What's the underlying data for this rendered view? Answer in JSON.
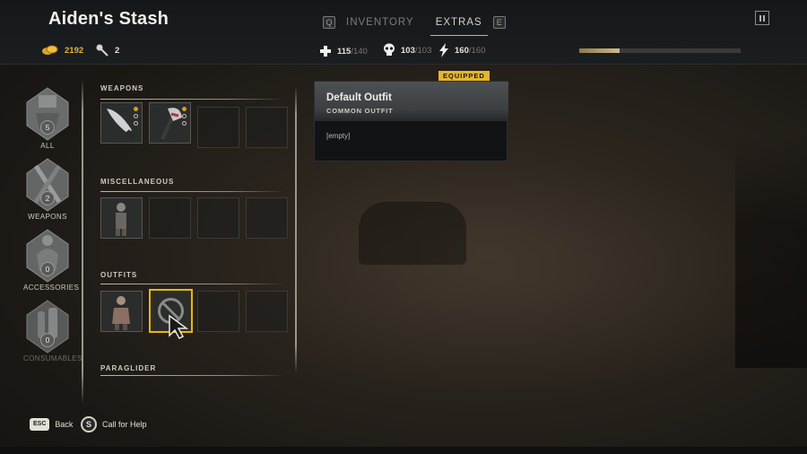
{
  "header": {
    "title": "Aiden's Stash",
    "tabs": [
      {
        "key": "Q",
        "label": ""
      },
      {
        "label": "INVENTORY",
        "active": false
      },
      {
        "label": "EXTRAS",
        "active": true
      },
      {
        "key": "E",
        "label": ""
      }
    ],
    "tab_prev_key": "Q",
    "tab_inventory": "INVENTORY",
    "tab_extras": "EXTRAS",
    "tab_next_key": "E",
    "pause_icon": "pause-icon"
  },
  "stats": {
    "gold_value": "2192",
    "lockpick_value": "2",
    "health_value": "115",
    "health_max": "/140",
    "immunity_value": "103",
    "immunity_max": "/103",
    "stamina_value": "160",
    "stamina_max": "/160",
    "xp_fill_fraction": 0.25
  },
  "categories": [
    {
      "name": "ALL",
      "count": "5",
      "dim": false
    },
    {
      "name": "WEAPONS",
      "count": "2",
      "dim": false
    },
    {
      "name": "ACCESSORIES",
      "count": "0",
      "dim": false
    },
    {
      "name": "CONSUMABLES",
      "count": "0",
      "dim": true
    }
  ],
  "sections": {
    "weapons": "WEAPONS",
    "miscellaneous": "MISCELLANEOUS",
    "outfits": "OUTFITS",
    "paraglider": "PARAGLIDER"
  },
  "detail": {
    "badge": "EQUIPPED",
    "title": "Default Outfit",
    "subtitle": "COMMON OUTFIT",
    "body": "[empty]"
  },
  "hints": {
    "back_key": "ESC",
    "back_label": "Back",
    "help_key": "S",
    "help_label": "Call for Help"
  },
  "colors": {
    "accent_gold": "#e2b522",
    "rarity_orange": "#d99d2b"
  }
}
